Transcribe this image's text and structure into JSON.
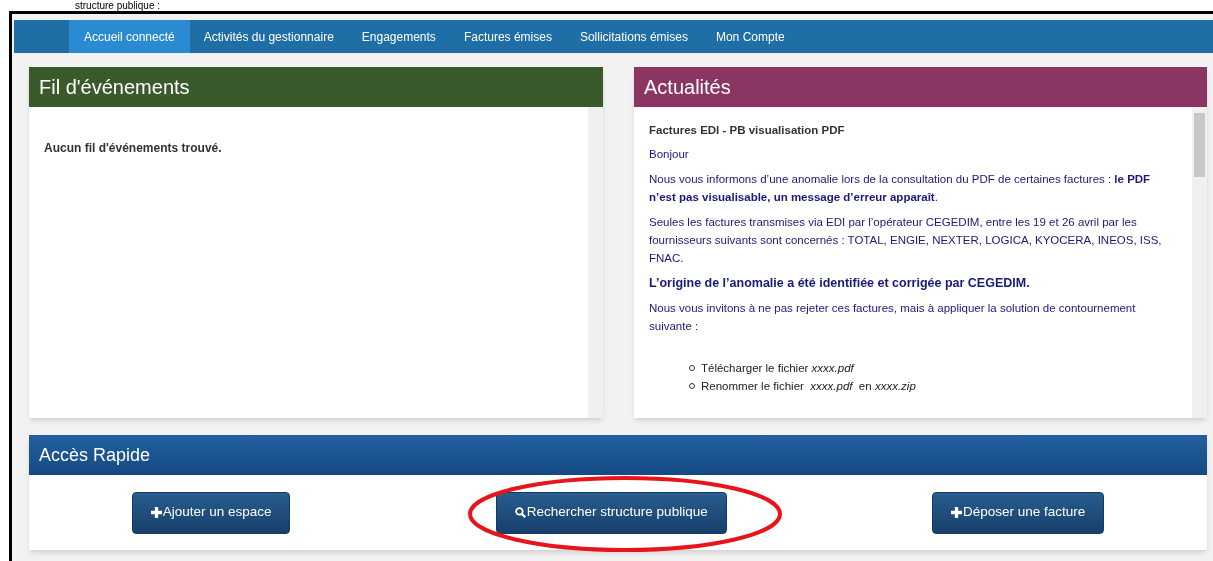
{
  "document_caption": "structure publique :",
  "nav": [
    {
      "label": "Accueil connecté",
      "selected": true
    },
    {
      "label": "Activités du gestionnaire",
      "selected": false
    },
    {
      "label": "Engagements",
      "selected": false
    },
    {
      "label": "Factures émises",
      "selected": false
    },
    {
      "label": "Sollicitations émises",
      "selected": false
    },
    {
      "label": "Mon Compte",
      "selected": false
    }
  ],
  "events_panel": {
    "title": "Fil d'événements",
    "empty_message": "Aucun fil d'événements trouvé."
  },
  "news_panel": {
    "title": "Actualités",
    "heading": "Factures EDI - PB visualisation PDF",
    "paragraphs": [
      {
        "kind": "text",
        "text": "Bonjour"
      },
      {
        "kind": "text",
        "text": "Nous vous informons d’une anomalie lors de la consultation du PDF de certaines factures : **le PDF n’est pas visualisable, un message d’erreur apparaît**."
      },
      {
        "kind": "text",
        "text": "Seules les factures transmises via EDI par l’opérateur CEGEDIM, entre les 19 et 26 avril par les fournisseurs suivants sont concernés : TOTAL, ENGIE, NEXTER, LOGICA, KYOCERA, INEOS, ISS, FNAC."
      },
      {
        "kind": "strong",
        "text": "L’origine de l’anomalie a été identifiée et corrigée par CEGEDIM."
      },
      {
        "kind": "text",
        "text": "Nous vous invitons à ne pas rejeter ces factures, mais à appliquer la solution de contournement suivante :"
      }
    ],
    "steps": [
      "Télécharger le fichier *xxxx.pdf*",
      "Renommer le fichier  *xxxx.pdf*  en *xxxx.zip*"
    ]
  },
  "quick_access": {
    "title": "Accès Rapide",
    "buttons": [
      {
        "kind": "add",
        "label": "Ajouter un espace",
        "highlighted": false
      },
      {
        "kind": "search",
        "label": "Rechercher structure publique",
        "highlighted": true
      },
      {
        "kind": "add",
        "label": "Déposer une facture",
        "highlighted": false
      }
    ]
  }
}
